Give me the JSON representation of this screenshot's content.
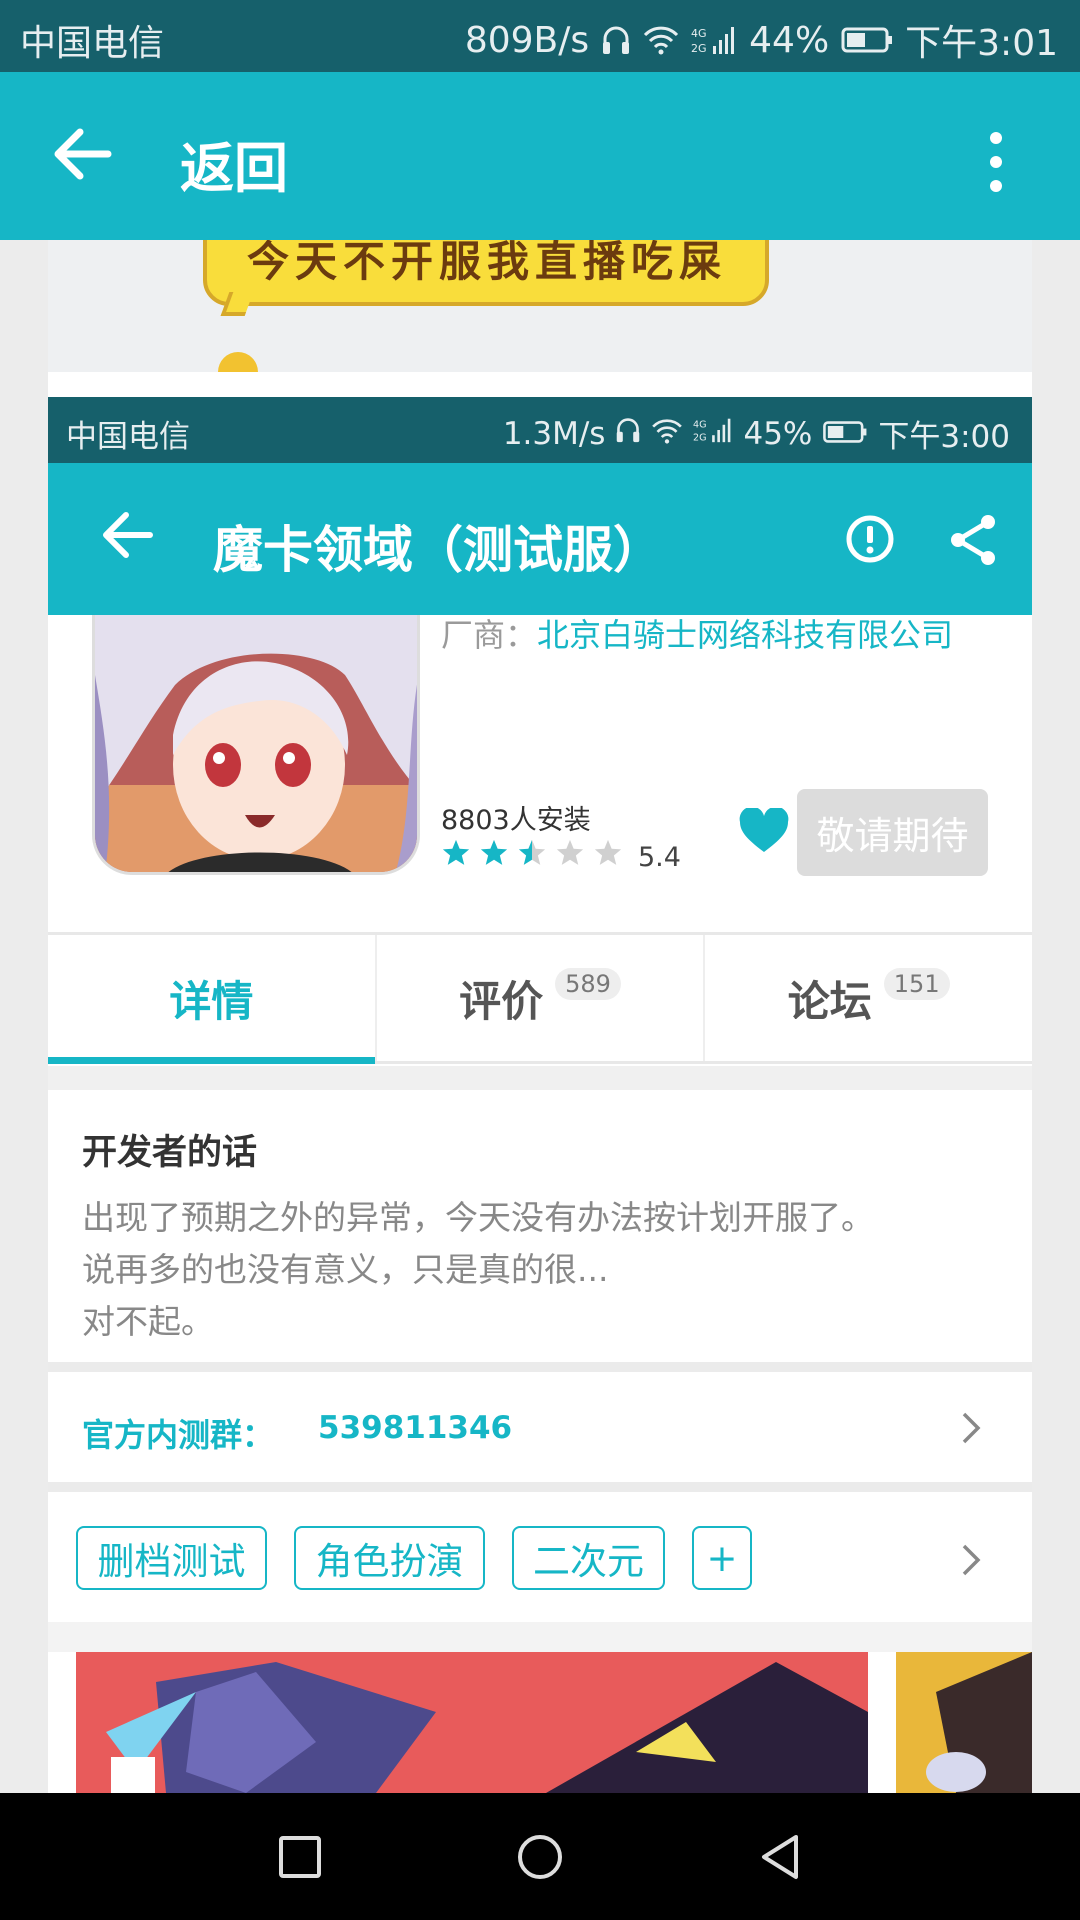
{
  "outer_status": {
    "carrier": "中国电信",
    "speed": "809B/s",
    "network": "4G 2G",
    "battery": "44%",
    "time": "下午3:01"
  },
  "outer_appbar": {
    "title": "返回",
    "back_icon": "back-arrow-icon",
    "more_icon": "more-vert-icon"
  },
  "banner": {
    "text": "今天不开服我直播吃屎"
  },
  "inner_status": {
    "carrier": "中国电信",
    "speed": "1.3M/s",
    "network": "4G 2G",
    "battery": "45%",
    "time": "下午3:00"
  },
  "inner_appbar": {
    "title": "魔卡领域（测试服）",
    "back_icon": "back-arrow-icon",
    "report_icon": "exclamation-circle-icon",
    "share_icon": "share-icon"
  },
  "game": {
    "vendor_label": "厂商：",
    "vendor_name": "北京白骑士网络科技有限公司",
    "installs": "8803人安装",
    "rating": 5.4,
    "rating_text": "5.4",
    "stars_filled": 2.5,
    "stars_total": 5,
    "expect_button": "敬请期待",
    "accent_color": "#16b6c6"
  },
  "tabs": [
    {
      "label": "详情",
      "count": "",
      "active": true
    },
    {
      "label": "评价",
      "count": "589",
      "active": false
    },
    {
      "label": "论坛",
      "count": "151",
      "active": false
    }
  ],
  "developer": {
    "heading": "开发者的话",
    "lines": [
      "出现了预期之外的异常，今天没有办法按计划开服了。",
      "说再多的也没有意义，只是真的很...",
      "对不起。"
    ]
  },
  "group": {
    "label": "官方内测群：",
    "number": "539811346"
  },
  "tags": [
    "删档测试",
    "角色扮演",
    "二次元",
    "+"
  ]
}
